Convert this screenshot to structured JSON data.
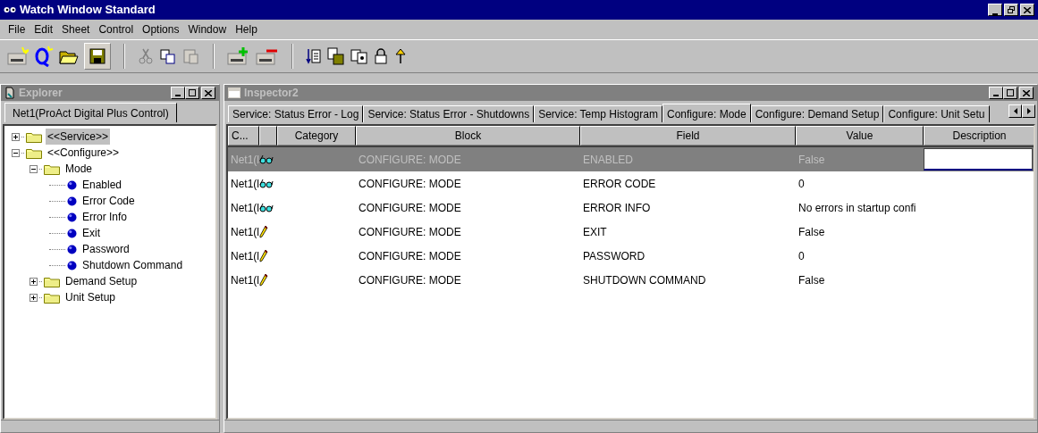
{
  "window": {
    "title": "Watch Window Standard"
  },
  "menu": [
    "File",
    "Edit",
    "Sheet",
    "Control",
    "Options",
    "Window",
    "Help"
  ],
  "explorer": {
    "title": "Explorer",
    "tab": "Net1(ProAct Digital Plus Control)",
    "tree": [
      {
        "label": "<<Service>>",
        "kind": "folder",
        "expanded": false,
        "selected": true
      },
      {
        "label": "<<Configure>>",
        "kind": "folder",
        "expanded": true,
        "selected": false,
        "children": [
          {
            "label": "Mode",
            "kind": "folder",
            "expanded": true,
            "selected": false,
            "children": [
              {
                "label": "Enabled",
                "kind": "leaf",
                "selected": false
              },
              {
                "label": "Error Code",
                "kind": "leaf",
                "selected": false
              },
              {
                "label": "Error Info",
                "kind": "leaf",
                "selected": false
              },
              {
                "label": "Exit",
                "kind": "leaf",
                "selected": false
              },
              {
                "label": "Password",
                "kind": "leaf",
                "selected": false
              },
              {
                "label": "Shutdown Command",
                "kind": "leaf",
                "selected": false
              }
            ]
          },
          {
            "label": "Demand Setup",
            "kind": "folder",
            "expanded": false,
            "selected": false
          },
          {
            "label": "Unit Setup",
            "kind": "folder",
            "expanded": false,
            "selected": false
          }
        ]
      }
    ]
  },
  "inspector": {
    "title": "Inspector2",
    "tabs": [
      {
        "label": "Service: Status Error - Log",
        "selected": false
      },
      {
        "label": "Service: Status Error - Shutdowns",
        "selected": false
      },
      {
        "label": "Service: Temp Histogram",
        "selected": false
      },
      {
        "label": "Configure:  Mode",
        "selected": true
      },
      {
        "label": "Configure: Demand Setup",
        "selected": false
      },
      {
        "label": "Configure: Unit Setu",
        "selected": false
      }
    ],
    "columns": [
      "C...",
      "",
      "Category",
      "Block",
      "Field",
      "Value",
      "Description"
    ],
    "rows": [
      {
        "source": "Net1(l",
        "kind": "read",
        "block": "CONFIGURE:  MODE",
        "field": "ENABLED",
        "value": "False",
        "selected": true
      },
      {
        "source": "Net1(l",
        "kind": "read",
        "block": "CONFIGURE:  MODE",
        "field": "ERROR CODE",
        "value": "0",
        "selected": false
      },
      {
        "source": "Net1(l",
        "kind": "read",
        "block": "CONFIGURE:  MODE",
        "field": "ERROR INFO",
        "value": "No errors in startup confi",
        "selected": false
      },
      {
        "source": "Net1(l",
        "kind": "write",
        "block": "CONFIGURE:  MODE",
        "field": "EXIT",
        "value": "False",
        "selected": false
      },
      {
        "source": "Net1(l",
        "kind": "write",
        "block": "CONFIGURE:  MODE",
        "field": "PASSWORD",
        "value": "0",
        "selected": false
      },
      {
        "source": "Net1(l",
        "kind": "write",
        "block": "CONFIGURE:  MODE",
        "field": "SHUTDOWN COMMAND",
        "value": "False",
        "selected": false
      }
    ]
  }
}
